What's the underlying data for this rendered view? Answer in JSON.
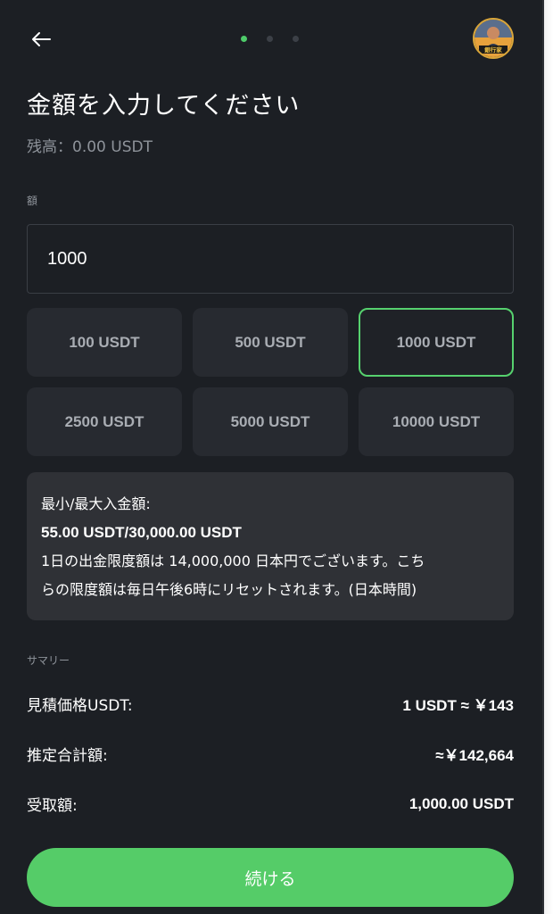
{
  "header": {
    "back_icon": "arrow-left-icon",
    "step_total": 3,
    "step_current": 1,
    "avatar_caption": "銀行家"
  },
  "title": "金額を入力してください",
  "balance": "残高：0.00 USDT",
  "amount_field": {
    "label": "額",
    "value": "1000"
  },
  "presets": [
    {
      "label": "100 USDT",
      "selected": false
    },
    {
      "label": "500 USDT",
      "selected": false
    },
    {
      "label": "1000 USDT",
      "selected": true
    },
    {
      "label": "2500 USDT",
      "selected": false
    },
    {
      "label": "5000 USDT",
      "selected": false
    },
    {
      "label": "10000 USDT",
      "selected": false
    }
  ],
  "info": {
    "line1": "最小/最大入金額:",
    "line2": "55.00 USDT/30,000.00 USDT",
    "line3": "1日の出金限度額は 14,000,000 日本円でございます。こち",
    "line4": "らの限度額は毎日午後6時にリセットされます。(日本時間)"
  },
  "summary": {
    "label": "サマリー",
    "rows": [
      {
        "key": "見積価格USDT:",
        "value": "1 USDT ≈ ￥143"
      },
      {
        "key": "推定合計額:",
        "value": "≈￥142,664"
      },
      {
        "key": "受取額:",
        "value": "1,000.00 USDT"
      }
    ]
  },
  "continue_label": "続ける",
  "colors": {
    "background": "#1c1f24",
    "accent": "#55cc68",
    "chip": "#272a30",
    "info_box": "#2f3136",
    "muted_text": "#8e939a"
  }
}
